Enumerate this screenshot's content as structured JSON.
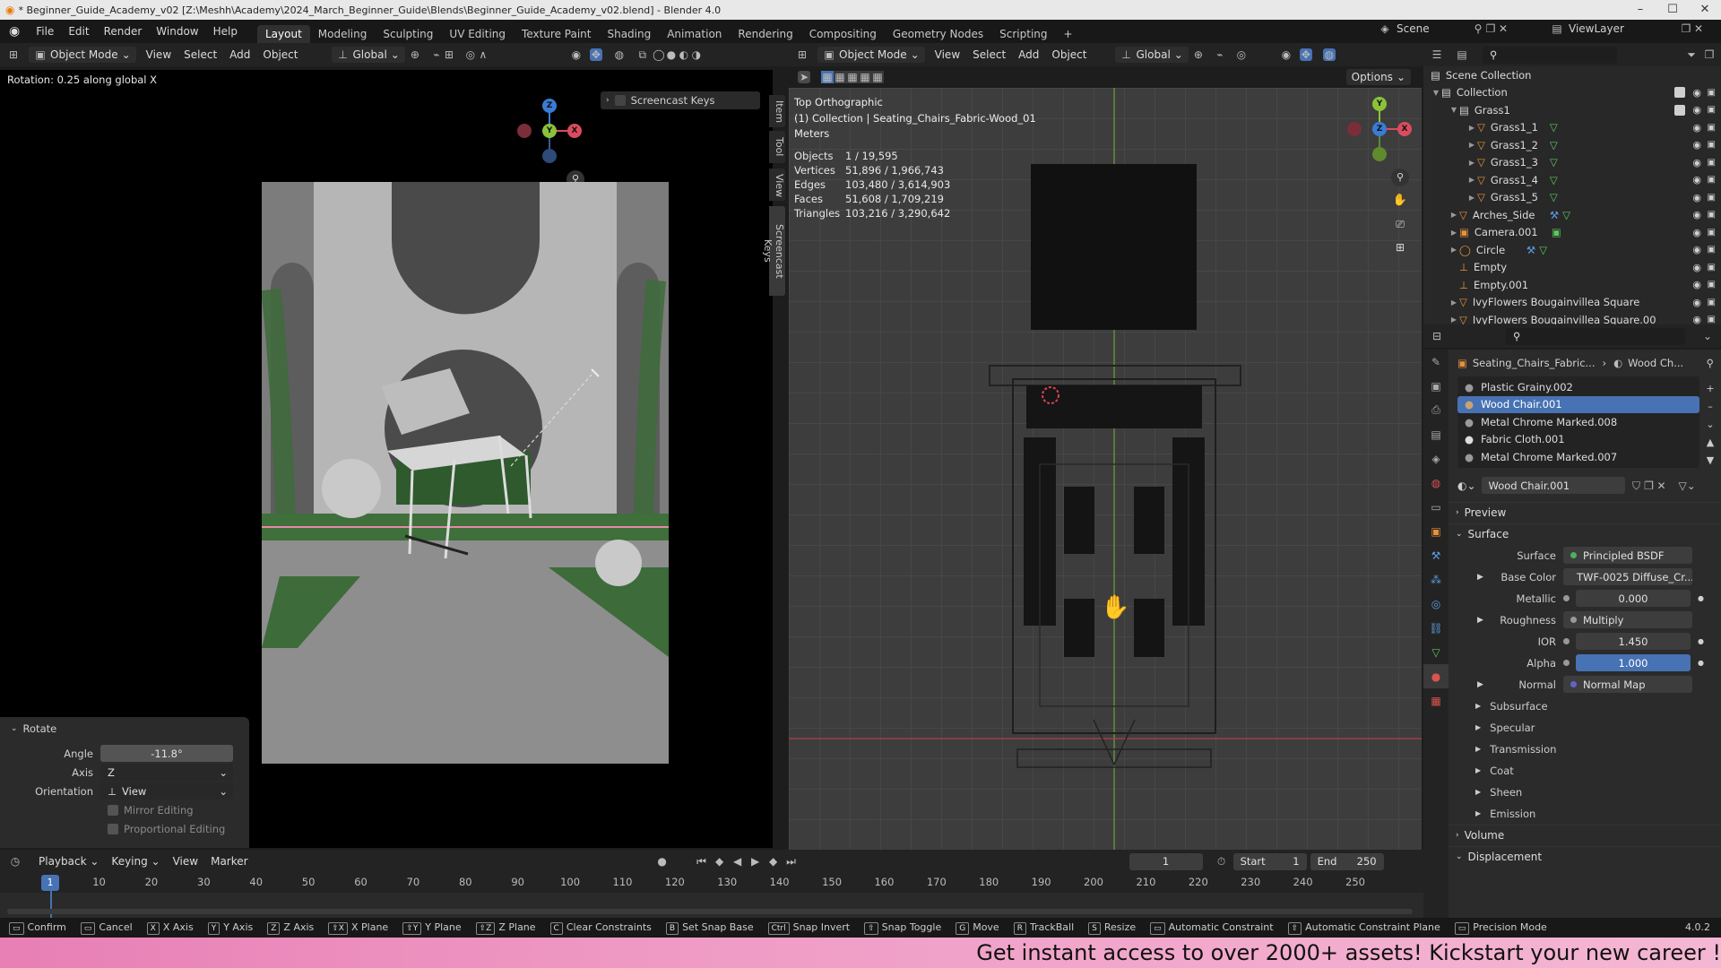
{
  "titlebar": {
    "title": "* Beginner_Guide_Academy_v02 [Z:\\Meshh\\Academy\\2024_March_Beginner_Guide\\Blends\\Beginner_Guide_Academy_v02.blend] - Blender 4.0"
  },
  "menu": [
    "File",
    "Edit",
    "Render",
    "Window",
    "Help"
  ],
  "workspaces": [
    "Layout",
    "Modeling",
    "Sculpting",
    "UV Editing",
    "Texture Paint",
    "Shading",
    "Animation",
    "Rendering",
    "Compositing",
    "Geometry Nodes",
    "Scripting"
  ],
  "scene": {
    "name": "Scene",
    "view_layer": "ViewLayer"
  },
  "left_header": {
    "mode": "Object Mode",
    "items": [
      "View",
      "Select",
      "Add",
      "Object"
    ],
    "orientation": "Global"
  },
  "left_status": "Rotation: 0.25 along global X",
  "screencast": {
    "label": "Screencast Keys"
  },
  "side_tabs": [
    "Item",
    "Tool",
    "View",
    "Screencast Keys"
  ],
  "right_header": {
    "mode": "Object Mode",
    "items": [
      "View",
      "Select",
      "Add",
      "Object"
    ],
    "orientation": "Global",
    "options": "Options"
  },
  "viewport_info": {
    "view": "Top Orthographic",
    "collection": "(1) Collection | Seating_Chairs_Fabric-Wood_01",
    "units": "Meters"
  },
  "stats": [
    {
      "label": "Objects",
      "value": "1 / 19,595"
    },
    {
      "label": "Vertices",
      "value": "51,896 / 1,966,743"
    },
    {
      "label": "Edges",
      "value": "103,480 / 3,614,903"
    },
    {
      "label": "Faces",
      "value": "51,608 / 1,709,219"
    },
    {
      "label": "Triangles",
      "value": "103,216 / 3,290,642"
    }
  ],
  "redo_panel": {
    "title": "Rotate",
    "angle_label": "Angle",
    "angle": "-11.8°",
    "axis_label": "Axis",
    "axis": "Z",
    "orientation_label": "Orientation",
    "orientation": "View",
    "mirror": "Mirror Editing",
    "proportional": "Proportional Editing"
  },
  "outliner": {
    "root": "Scene Collection",
    "collection": "Collection",
    "items": [
      {
        "name": "Grass1",
        "indent": 2
      },
      {
        "name": "Grass1_1",
        "indent": 3
      },
      {
        "name": "Grass1_2",
        "indent": 3
      },
      {
        "name": "Grass1_3",
        "indent": 3
      },
      {
        "name": "Grass1_4",
        "indent": 3
      },
      {
        "name": "Grass1_5",
        "indent": 3
      },
      {
        "name": "Arches_Side",
        "indent": 2
      },
      {
        "name": "Camera.001",
        "indent": 2
      },
      {
        "name": "Circle",
        "indent": 2
      },
      {
        "name": "Empty",
        "indent": 2
      },
      {
        "name": "Empty.001",
        "indent": 2
      },
      {
        "name": "IvyFlowers Bougainvillea Square",
        "indent": 2
      },
      {
        "name": "IvyFlowers Bougainvillea Square.00",
        "indent": 2
      }
    ]
  },
  "properties": {
    "breadcrumb_object": "Seating_Chairs_Fabric...",
    "breadcrumb_material": "Wood Ch...",
    "slots": [
      "Plastic Grainy.002",
      "Wood Chair.001",
      "Metal Chrome Marked.008",
      "Fabric Cloth.001",
      "Metal Chrome Marked.007"
    ],
    "selected_slot": 1,
    "material_name": "Wood Chair.001",
    "sections": {
      "preview": "Preview",
      "surface": "Surface",
      "volume": "Volume",
      "displacement": "Displacement"
    },
    "rows": [
      {
        "label": "Surface",
        "value": "Principled BSDF",
        "type": "link",
        "dot": "#4fae5f"
      },
      {
        "label": "Base Color",
        "value": "TWF-0025 Diffuse_Cr...",
        "type": "link",
        "dot": "#c7c728"
      },
      {
        "label": "Metallic",
        "value": "0.000",
        "type": "num",
        "dot": "#999999"
      },
      {
        "label": "Roughness",
        "value": "Multiply",
        "type": "link",
        "dot": "#999999"
      },
      {
        "label": "IOR",
        "value": "1.450",
        "type": "num",
        "dot": "#999999"
      },
      {
        "label": "Alpha",
        "value": "1.000",
        "type": "blue",
        "dot": "#999999"
      },
      {
        "label": "Normal",
        "value": "Normal Map",
        "type": "link",
        "dot": "#6363c7"
      }
    ],
    "subpanels": [
      "Subsurface",
      "Specular",
      "Transmission",
      "Coat",
      "Sheen",
      "Emission"
    ]
  },
  "timeline": {
    "menus": [
      "Playback",
      "Keying",
      "View",
      "Marker"
    ],
    "current_frame": "1",
    "start_label": "Start",
    "start": "1",
    "end_label": "End",
    "end": "250",
    "ticks": [
      "1",
      "10",
      "20",
      "30",
      "40",
      "50",
      "60",
      "70",
      "80",
      "90",
      "100",
      "110",
      "120",
      "130",
      "140",
      "150",
      "160",
      "170",
      "180",
      "190",
      "200",
      "210",
      "220",
      "230",
      "240",
      "250"
    ]
  },
  "statusbar": [
    {
      "key": "",
      "label": "Confirm"
    },
    {
      "key": "",
      "label": "Cancel"
    },
    {
      "key": "X",
      "label": "X Axis"
    },
    {
      "key": "Y",
      "label": "Y Axis"
    },
    {
      "key": "Z",
      "label": "Z Axis"
    },
    {
      "key": "⇧X",
      "label": "X Plane"
    },
    {
      "key": "⇧Y",
      "label": "Y Plane"
    },
    {
      "key": "⇧Z",
      "label": "Z Plane"
    },
    {
      "key": "C",
      "label": "Clear Constraints"
    },
    {
      "key": "B",
      "label": "Set Snap Base"
    },
    {
      "key": "Ctrl",
      "label": "Snap Invert"
    },
    {
      "key": "⇧",
      "label": "Snap Toggle"
    },
    {
      "key": "G",
      "label": "Move"
    },
    {
      "key": "R",
      "label": "TrackBall"
    },
    {
      "key": "S",
      "label": "Resize"
    },
    {
      "key": "",
      "label": "Automatic Constraint"
    },
    {
      "key": "⇧",
      "label": "Automatic Constraint Plane"
    },
    {
      "key": "",
      "label": "Precision Mode"
    }
  ],
  "version": "4.0.2",
  "banner": "Get instant access to over 2000+ assets! Kickstart your new career !"
}
